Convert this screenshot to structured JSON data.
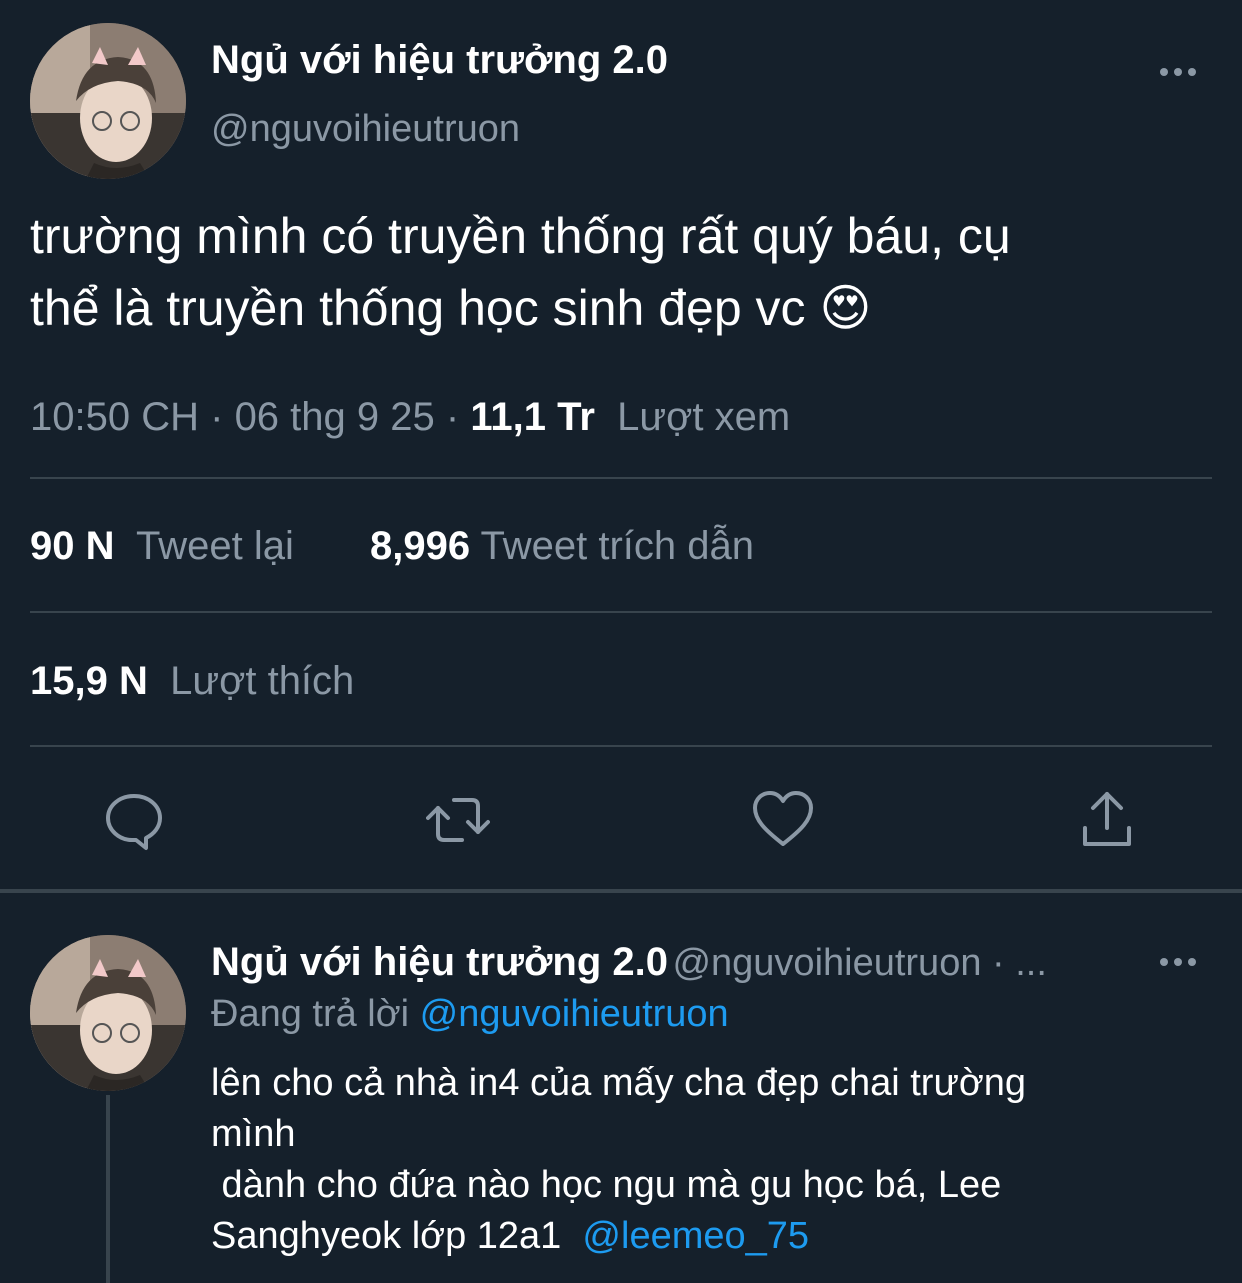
{
  "tweet": {
    "display_name": "Ngủ với hiệu trưởng 2.0",
    "handle": "@nguvoihieutruon",
    "more_icon": "more-icon",
    "text_line1": "trường mình có truyền thống rất quý báu, cụ",
    "text_line2": "thể là truyền thống học sinh đẹp vc",
    "emoji": "😍",
    "time": "10:50 CH",
    "dot": "·",
    "date": "06 thg 9 25",
    "views_count": "11,1 Tr",
    "views_label": "Lượt xem",
    "retweets_count": "90 N",
    "retweets_label": "Tweet lại",
    "quotes_count": "8,996",
    "quotes_label": "Tweet trích dẫn",
    "likes_count": "15,9 N",
    "likes_label": "Lượt thích",
    "actions": [
      "reply-icon",
      "retweet-icon",
      "like-icon",
      "share-icon"
    ]
  },
  "reply": {
    "display_name": "Ngủ với hiệu trưởng 2.0",
    "handle_truncated": "@nguvoihieutruon · ...",
    "replying_to_label": "Đang trả lời",
    "replying_to_handle": "@nguvoihieutruon",
    "line1": "lên cho cả nhà in4 của mấy cha đẹp chai trường",
    "line2": "mình",
    "line3": " dành cho đứa nào học ngu mà gu học bá, Lee",
    "line4": "Sanghyeok lớp 12a1",
    "mention": "@leemeo_75"
  },
  "colors": {
    "background": "#15202b",
    "secondary_text": "#8b98a5",
    "link": "#1d9bf0",
    "divider": "#38444d"
  }
}
